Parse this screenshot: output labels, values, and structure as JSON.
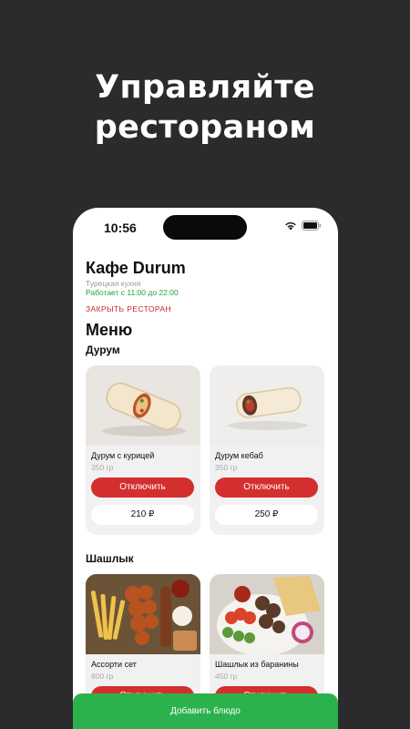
{
  "promo": {
    "line1": "Управляйте",
    "line2": "рестораном"
  },
  "status_bar": {
    "time": "10:56",
    "icons": [
      "wifi-icon",
      "battery-icon"
    ]
  },
  "restaurant": {
    "name": "Кафе Durum",
    "cuisine": "Турецкая кухня",
    "hours": "Работает с 11:00 до 22:00",
    "close_label": "ЗАКРЫТЬ РЕСТОРАН"
  },
  "menu": {
    "title": "Меню",
    "categories": [
      {
        "name": "Дурум",
        "items": [
          {
            "name": "Дурум с курицей",
            "weight": "350 гр",
            "toggle_label": "Отключить",
            "price": "210 ₽"
          },
          {
            "name": "Дурум кебаб",
            "weight": "350 гр",
            "toggle_label": "Отключить",
            "price": "250 ₽"
          }
        ]
      },
      {
        "name": "Шашлык",
        "items": [
          {
            "name": "Ассорти сет",
            "weight": "800 гр",
            "toggle_label": "Отключить",
            "price": ""
          },
          {
            "name": "Шашлык из баранины",
            "weight": "450 гр",
            "toggle_label": "Отключить",
            "price": ""
          }
        ]
      }
    ]
  },
  "add_button_label": "Добавить блюдо",
  "colors": {
    "background": "#2b2b2d",
    "accent_red": "#d32f2f",
    "status_green": "#22a33a",
    "add_green": "#2bb24c"
  }
}
